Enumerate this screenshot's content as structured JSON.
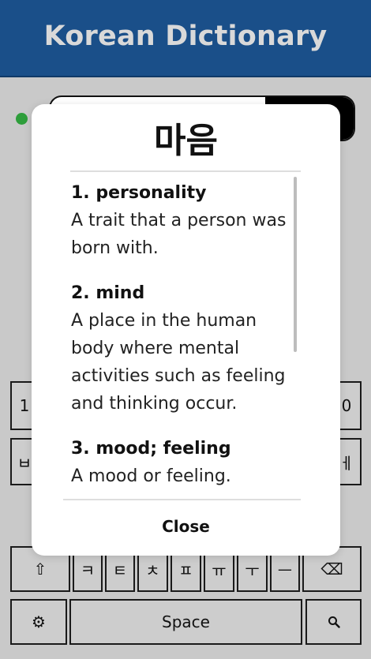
{
  "header": {
    "title": "Korean Dictionary"
  },
  "search": {
    "value": "",
    "button_label": ""
  },
  "keyboard": {
    "row1_left": "1",
    "row1_right": "0",
    "row2_left": "ㅂ",
    "row2_right": "ㅔ",
    "row4": [
      "⇧",
      "ㅋ",
      "ㅌ",
      "ㅊ",
      "ㅍ",
      "ㅠ",
      "ㅜ",
      "ㅡ",
      "⌫"
    ],
    "row5": {
      "settings": "⚙",
      "space": "Space",
      "search": "🔍"
    }
  },
  "modal": {
    "word": "마음",
    "senses": [
      {
        "head": "1. personality",
        "definition": "A trait that a person was born with."
      },
      {
        "head": "2. mind",
        "definition": "A place in the human body where mental activities such as feeling and thinking occur."
      },
      {
        "head": "3. mood; feeling",
        "definition": "A mood or feeling."
      }
    ],
    "close_label": "Close"
  },
  "colors": {
    "header_bg": "#1a4f89",
    "status_dot": "#2e9e3b",
    "keyboard_bg": "#c9c9c9"
  }
}
